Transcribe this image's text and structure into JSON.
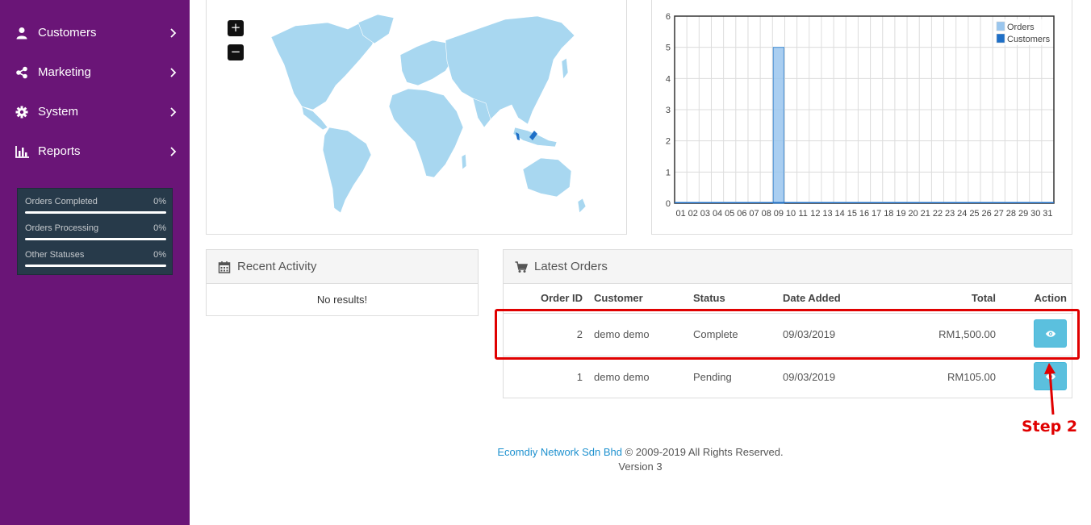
{
  "sidebar": {
    "items": [
      {
        "label": "Customers",
        "icon": "user-icon"
      },
      {
        "label": "Marketing",
        "icon": "share-icon"
      },
      {
        "label": "System",
        "icon": "cog-icon"
      },
      {
        "label": "Reports",
        "icon": "bar-chart-icon"
      }
    ],
    "stats": [
      {
        "label": "Orders Completed",
        "percent": "0%",
        "progress": 0
      },
      {
        "label": "Orders Processing",
        "percent": "0%",
        "progress": 0
      },
      {
        "label": "Other Statuses",
        "percent": "0%",
        "progress": 0
      }
    ]
  },
  "map": {
    "zoom_in": "+",
    "zoom_out": "−",
    "land_color": "#a8d7f0",
    "highlight_color": "#1e6fc7"
  },
  "chart_data": {
    "type": "bar",
    "x": [
      "01",
      "02",
      "03",
      "04",
      "05",
      "06",
      "07",
      "08",
      "09",
      "10",
      "11",
      "12",
      "13",
      "14",
      "15",
      "16",
      "17",
      "18",
      "19",
      "20",
      "21",
      "22",
      "23",
      "24",
      "25",
      "26",
      "27",
      "28",
      "29",
      "30",
      "31"
    ],
    "series": [
      {
        "name": "Orders",
        "color": "#9ac6ee",
        "values": [
          0,
          0,
          0,
          0,
          0,
          0,
          0,
          0,
          5,
          0,
          0,
          0,
          0,
          0,
          0,
          0,
          0,
          0,
          0,
          0,
          0,
          0,
          0,
          0,
          0,
          0,
          0,
          0,
          0,
          0,
          0
        ]
      },
      {
        "name": "Customers",
        "color": "#1e6fc7",
        "values": [
          0,
          0,
          0,
          0,
          0,
          0,
          0,
          0,
          0,
          0,
          0,
          0,
          0,
          0,
          0,
          0,
          0,
          0,
          0,
          0,
          0,
          0,
          0,
          0,
          0,
          0,
          0,
          0,
          0,
          0,
          0
        ]
      }
    ],
    "y_ticks": [
      "0",
      "1",
      "2",
      "3",
      "4",
      "5",
      "6"
    ],
    "ylim": [
      0,
      6
    ],
    "grid": true,
    "legend": "top-right"
  },
  "recent_activity": {
    "title": "Recent Activity",
    "empty_text": "No results!"
  },
  "latest_orders": {
    "title": "Latest Orders",
    "columns": [
      "Order ID",
      "Customer",
      "Status",
      "Date Added",
      "Total",
      "Action"
    ],
    "rows": [
      {
        "id": "2",
        "customer": "demo demo",
        "status": "Complete",
        "date": "09/03/2019",
        "total": "RM1,500.00"
      },
      {
        "id": "1",
        "customer": "demo demo",
        "status": "Pending",
        "date": "09/03/2019",
        "total": "RM105.00"
      }
    ]
  },
  "annotation": {
    "step_label": "Step 2",
    "color": "#e00000"
  },
  "footer": {
    "company": "Ecomdiy Network Sdn Bhd",
    "copyright": "© 2009-2019 All Rights Reserved.",
    "version": "Version 3"
  }
}
